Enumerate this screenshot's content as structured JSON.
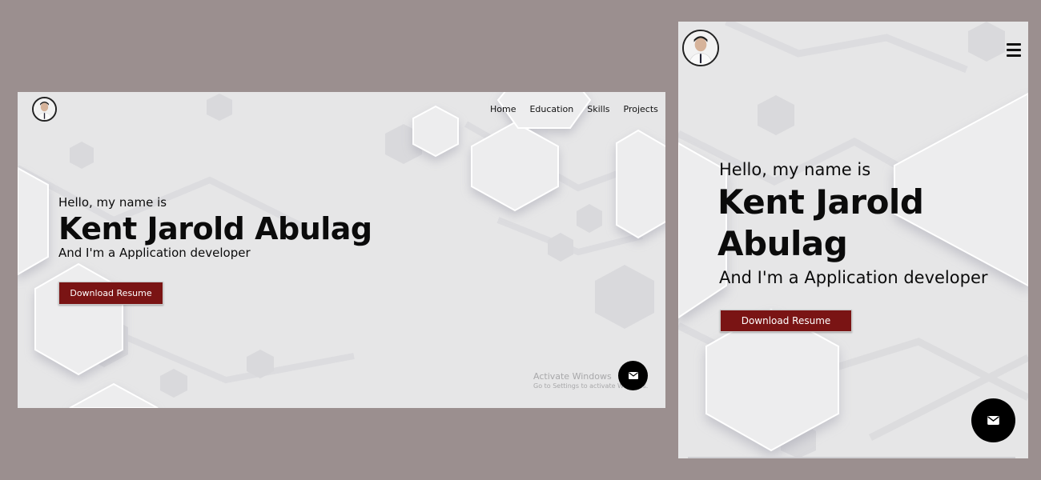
{
  "desktop": {
    "nav": [
      "Home",
      "Education",
      "Skills",
      "Projects"
    ],
    "hero": {
      "greeting": "Hello, my name is",
      "name": "Kent Jarold Abulag",
      "role": "And I'm a Application developer"
    },
    "download_button": "Download Resume",
    "watermark": {
      "title": "Activate Windows",
      "subtitle": "Go to Settings to activate Windows."
    },
    "contact_icon": "mail-icon",
    "avatar_icon": "profile-photo"
  },
  "mobile": {
    "menu_icon": "hamburger-menu-icon",
    "hero": {
      "greeting": "Hello, my name is",
      "name_line1": "Kent Jarold",
      "name_line2": "Abulag",
      "role": "And I'm a Application developer"
    },
    "download_button": "Download Resume",
    "contact_icon": "mail-icon"
  },
  "colors": {
    "page_background": "#9b8f8f",
    "hero_background": "#e6e6e7",
    "button_background": "#7a1414",
    "fab_background": "#000000"
  }
}
